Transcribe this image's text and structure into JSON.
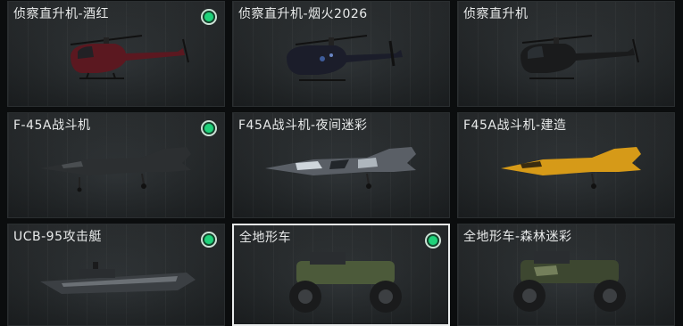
{
  "vehicles": [
    {
      "name": "侦察直升机-酒红",
      "owned": true,
      "selected": true,
      "colors": {
        "body": "#5b1820",
        "accent": "#8a2a33"
      }
    },
    {
      "name": "侦察直升机-烟火2026",
      "owned": false,
      "selected": false,
      "colors": {
        "body": "#1b1d2a",
        "accent": "#3e5c9a"
      }
    },
    {
      "name": "侦察直升机",
      "owned": false,
      "selected": false,
      "colors": {
        "body": "#1a1b1c",
        "accent": "#3a3c3e"
      }
    },
    {
      "name": "F-45A战斗机",
      "owned": true,
      "selected": false,
      "colors": {
        "body": "#2c2f31",
        "accent": "#4a4e51"
      }
    },
    {
      "name": "F45A战斗机-夜间迷彩",
      "owned": false,
      "selected": false,
      "colors": {
        "body": "#5a5f66",
        "accent": "#cfd6dc"
      }
    },
    {
      "name": "F45A战斗机-建造",
      "owned": false,
      "selected": false,
      "colors": {
        "body": "#d69a18",
        "accent": "#f2c04a"
      }
    },
    {
      "name": "UCB-95攻击艇",
      "owned": true,
      "selected": false,
      "colors": {
        "body": "#3b3f43",
        "accent": "#6b7075"
      }
    },
    {
      "name": "全地形车",
      "owned": true,
      "selected": true,
      "colors": {
        "body": "#4c5a3a",
        "accent": "#6d7d52"
      }
    },
    {
      "name": "全地形车-森林迷彩",
      "owned": false,
      "selected": false,
      "colors": {
        "body": "#3d4730",
        "accent": "#7a8560"
      }
    }
  ],
  "colors": {
    "owned_indicator": "#1fd27a",
    "selected_border": "#e9ecec"
  }
}
